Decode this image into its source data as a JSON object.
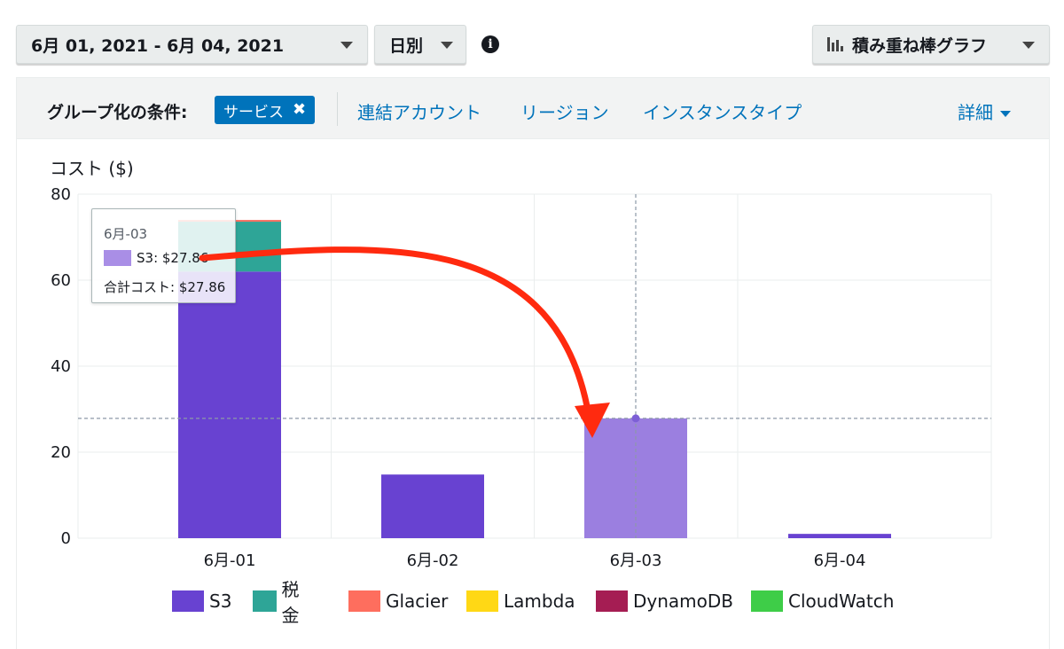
{
  "toolbar": {
    "date_range": "6月 01, 2021 - 6月 04, 2021",
    "granularity": "日別",
    "info_icon": "info-icon",
    "chart_type": "積み重ね棒グラフ"
  },
  "group_by": {
    "label": "グループ化の条件:",
    "active_token": "サービス",
    "options": [
      "連結アカウント",
      "リージョン",
      "インスタンスタイプ"
    ],
    "more": "詳細"
  },
  "tooltip": {
    "date": "6月-03",
    "series_line": "S3: $27.86",
    "total_line": "合計コスト: $27.86"
  },
  "colors": {
    "accent": "#0073bb",
    "arrow": "#ff2a0f",
    "s3_highlight": "#9b7fe0"
  },
  "chart_data": {
    "type": "bar",
    "stacked": true,
    "ylabel": "コスト ($)",
    "ylim": [
      0,
      80
    ],
    "yticks": [
      0,
      20,
      40,
      60,
      80
    ],
    "grid": true,
    "legend_position": "bottom",
    "categories": [
      "6月-01",
      "6月-02",
      "6月-03",
      "6月-04"
    ],
    "highlighted_category": "6月-03",
    "series": [
      {
        "name": "S3",
        "color": "#6842d1",
        "values": [
          62.0,
          14.8,
          27.86,
          1.0
        ]
      },
      {
        "name": "税金",
        "color": "#2ea597",
        "values": [
          11.6,
          0,
          0,
          0
        ]
      },
      {
        "name": "Glacier",
        "color": "#fe6e5e",
        "values": [
          0.4,
          0,
          0,
          0
        ]
      },
      {
        "name": "Lambda",
        "color": "#ffd815",
        "values": [
          0,
          0,
          0,
          0
        ]
      },
      {
        "name": "DynamoDB",
        "color": "#a51d53",
        "values": [
          0,
          0,
          0,
          0
        ]
      },
      {
        "name": "CloudWatch",
        "color": "#3ecd48",
        "values": [
          0,
          0,
          0,
          0
        ]
      }
    ]
  }
}
